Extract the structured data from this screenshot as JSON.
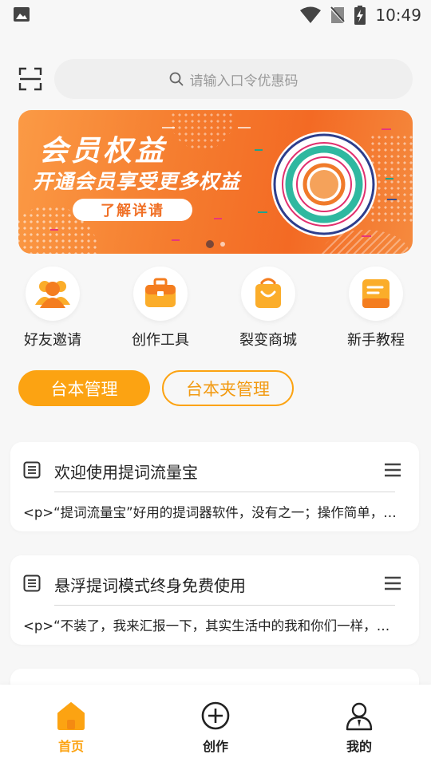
{
  "status_bar": {
    "time": "10:49"
  },
  "search": {
    "placeholder": "请输入口令优惠码"
  },
  "banner": {
    "title": "会员权益",
    "subtitle": "开通会员享受更多权益",
    "button_label": "了解详请",
    "page_count": 2,
    "active_page": 1
  },
  "shortcuts": [
    {
      "label": "好友邀请",
      "icon": "users-icon"
    },
    {
      "label": "创作工具",
      "icon": "toolbox-icon"
    },
    {
      "label": "裂变商城",
      "icon": "shopping-bag-icon"
    },
    {
      "label": "新手教程",
      "icon": "tutorial-doc-icon"
    }
  ],
  "tabs": [
    {
      "label": "台本管理",
      "active": true
    },
    {
      "label": "台本夹管理",
      "active": false
    }
  ],
  "scripts": [
    {
      "title": "欢迎使用提词流量宝",
      "preview": "<p>“提词流量宝”好用的提词器软件，没有之一；操作简单，功能强大"
    },
    {
      "title": "悬浮提词模式终身免费使用",
      "preview": "<p>“不装了，我来汇报一下，其实生活中的我和你们一样，每天都在努力"
    }
  ],
  "bottom_nav": [
    {
      "label": "首页",
      "icon": "home-icon",
      "active": true
    },
    {
      "label": "创作",
      "icon": "plus-circle-icon",
      "active": false
    },
    {
      "label": "我的",
      "icon": "profile-icon",
      "active": false
    }
  ],
  "colors": {
    "accent": "#fca312",
    "banner": "#f57d2f",
    "background": "#f7f7f7"
  }
}
